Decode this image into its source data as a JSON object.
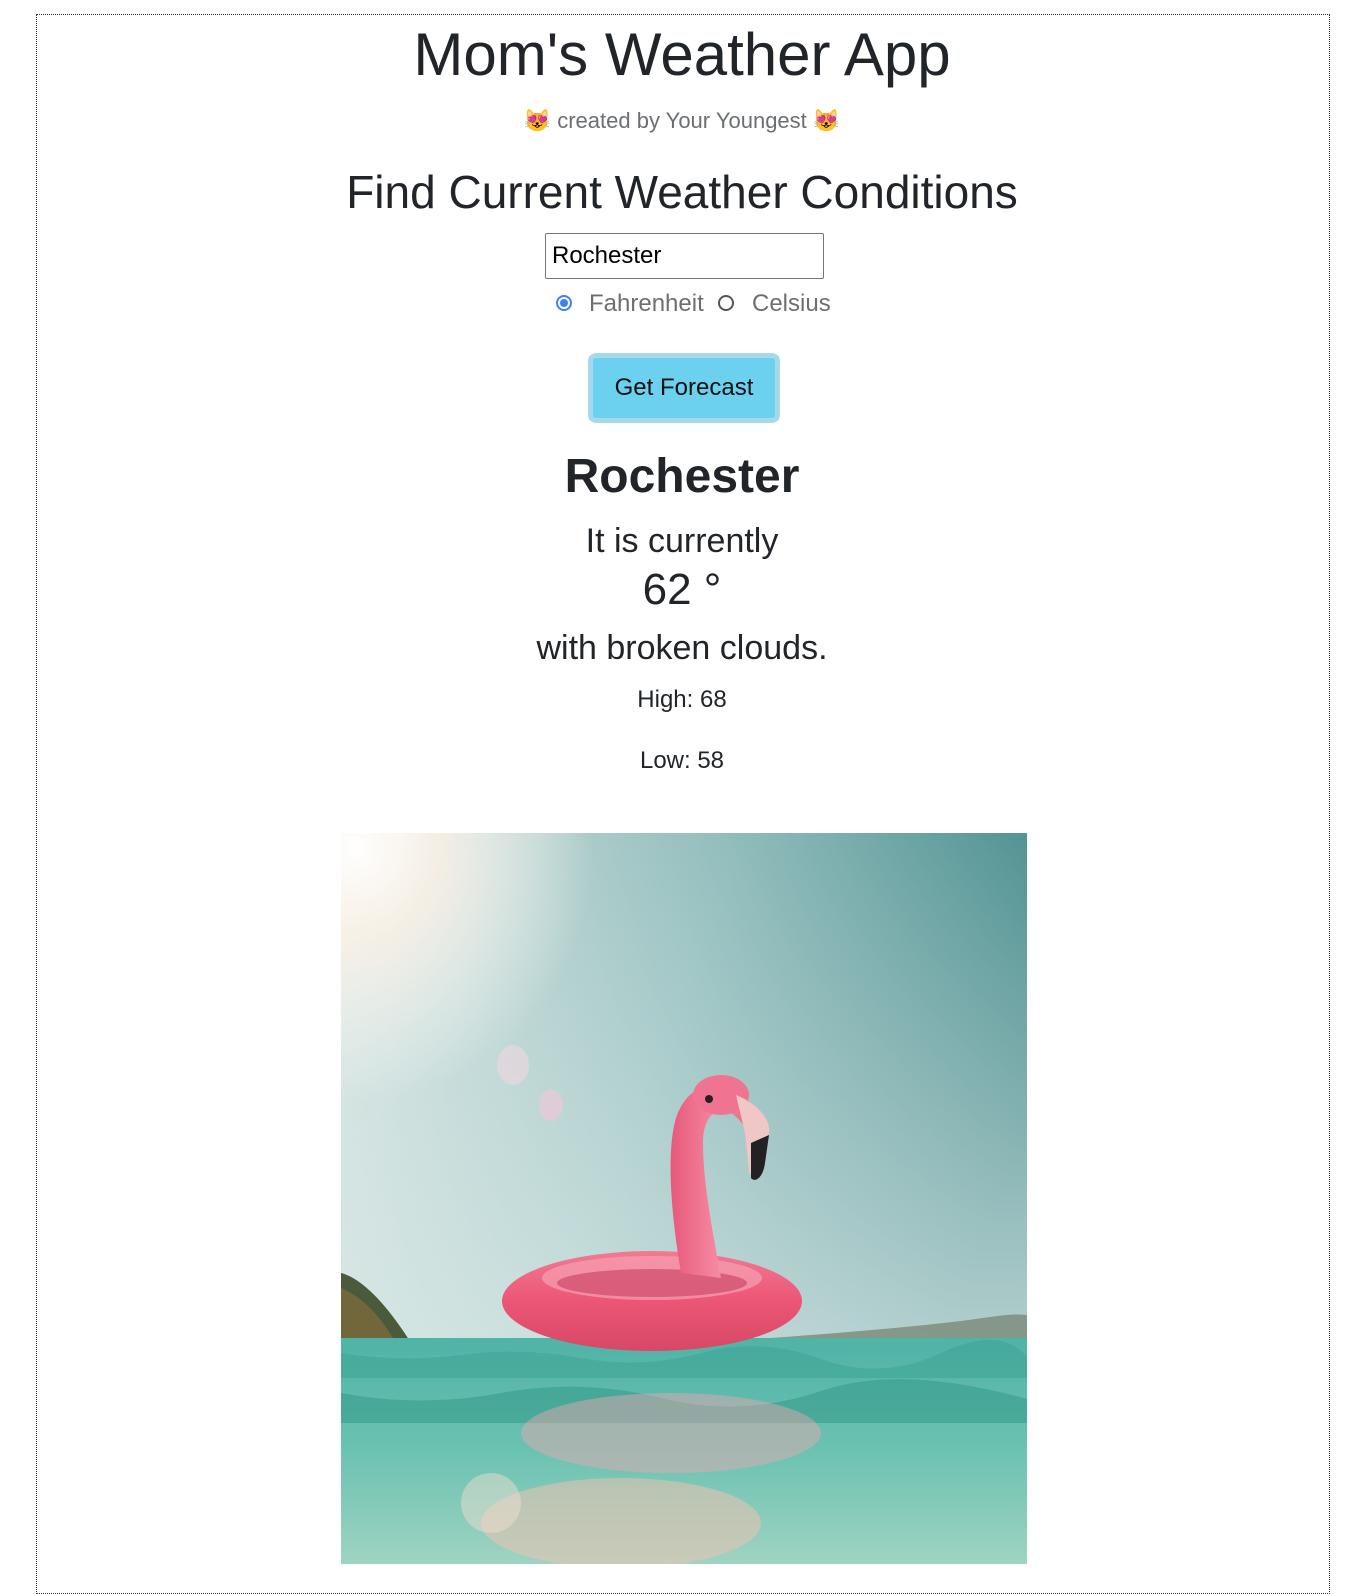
{
  "header": {
    "title": "Mom's Weather App",
    "subtitle_emoji_left": "😻",
    "subtitle_text": "created by Your Youngest",
    "subtitle_emoji_right": "😻"
  },
  "search": {
    "heading": "Find Current Weather Conditions",
    "city_value": "Rochester",
    "units": [
      {
        "label": "Fahrenheit",
        "selected": true
      },
      {
        "label": "Celsius",
        "selected": false
      }
    ],
    "button_label": "Get Forecast"
  },
  "result": {
    "city": "Rochester",
    "currently_label": "It is currently",
    "temperature": "62 °",
    "conditions": "with broken clouds.",
    "high": "High: 68",
    "low": "Low: 58"
  },
  "photo": {
    "description_icon": "flamingo-float-photo"
  },
  "colors": {
    "button_bg": "#6cd0ef",
    "button_border": "#a5d8e8",
    "radio_accent": "#3b82f6",
    "text": "#212529"
  }
}
